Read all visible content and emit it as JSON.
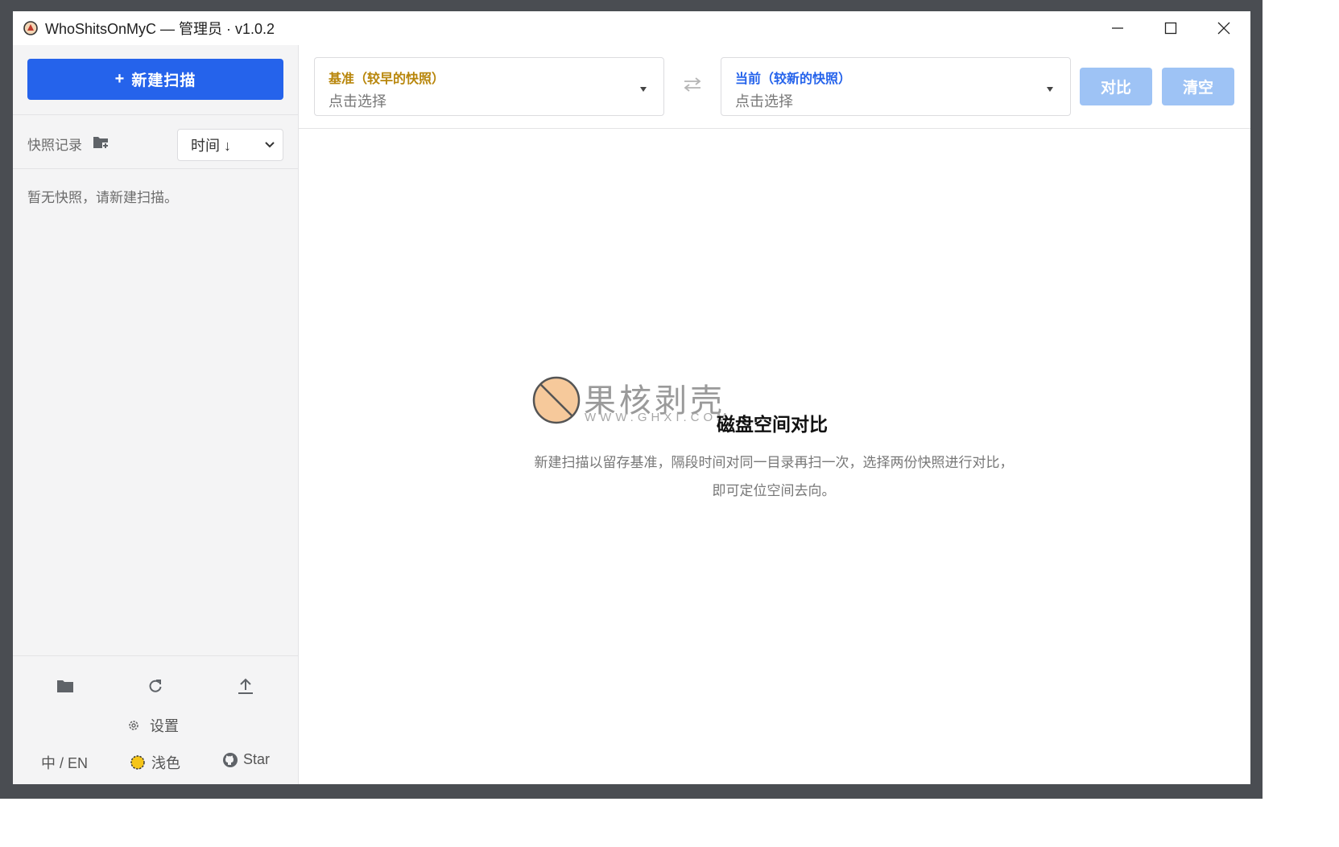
{
  "window": {
    "title": "WhoShitsOnMyC — 管理员 · v1.0.2",
    "controls": [
      "minimize",
      "maximize",
      "close"
    ]
  },
  "sidebar": {
    "new_scan_label": "新建扫描",
    "new_scan_plus": "+",
    "history_label": "快照记录",
    "sort_value": "时间 ↓",
    "empty_text": "暂无快照，请新建扫描。",
    "tools": [
      "folder-icon",
      "refresh-icon",
      "upload-icon"
    ],
    "settings_label": "设置",
    "lang_label": "中 / EN",
    "theme_label": "浅色",
    "star_label": "Star"
  },
  "topbar": {
    "base": {
      "title": "基准（较早的快照）",
      "placeholder": "点击选择",
      "title_color": "#b8860b"
    },
    "current": {
      "title": "当前（较新的快照）",
      "placeholder": "点击选择",
      "title_color": "#2563eb"
    },
    "compare_label": "对比",
    "clear_label": "清空"
  },
  "main": {
    "empty_title": "磁盘空间对比",
    "empty_desc": "新建扫描以留存基准，隔段时间对同一目录再扫一次，选择两份快照进行对比，即可定位空间去向。"
  },
  "watermark": {
    "text": "果核剥壳",
    "url": "WWW.GHXI.COM"
  },
  "colors": {
    "accent": "#2563eb",
    "accent_disabled": "#9ec3f5",
    "base_title": "#b8860b",
    "sidebar_bg": "#f4f4f5"
  }
}
